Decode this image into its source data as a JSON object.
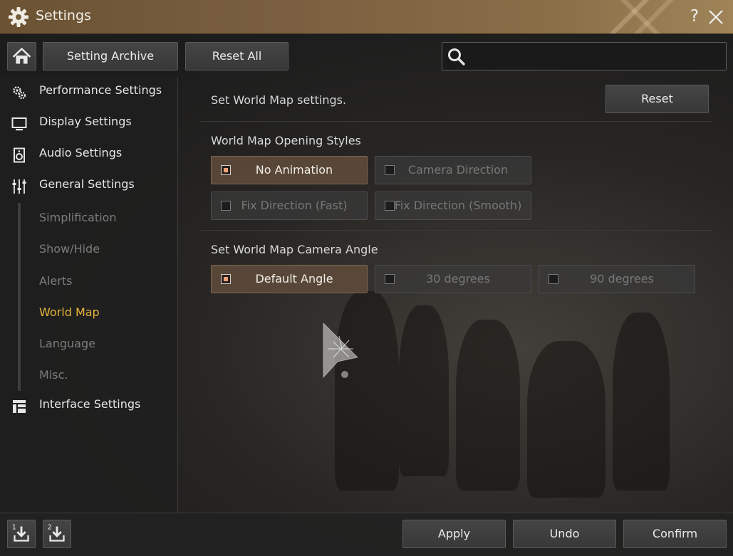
{
  "window": {
    "title": "Settings",
    "help_label": "?"
  },
  "toolbar": {
    "archive_label": "Setting Archive",
    "reset_all_label": "Reset All",
    "search_placeholder": ""
  },
  "sidebar": {
    "items": [
      {
        "label": "Performance Settings",
        "icon": "gears-icon"
      },
      {
        "label": "Display Settings",
        "icon": "monitor-icon"
      },
      {
        "label": "Audio Settings",
        "icon": "speaker-icon"
      },
      {
        "label": "General Settings",
        "icon": "sliders-icon"
      },
      {
        "label": "Interface Settings",
        "icon": "layout-icon"
      }
    ],
    "sub_items": [
      "Simplification",
      "Show/Hide",
      "Alerts",
      "World Map",
      "Language",
      "Misc."
    ],
    "active_sub_item": "World Map"
  },
  "main": {
    "description": "Set World Map settings.",
    "reset_label": "Reset",
    "opening_styles": {
      "title": "World Map Opening Styles",
      "options": [
        "No Animation",
        "Camera Direction",
        "Fix Direction (Fast)",
        "Fix Direction (Smooth)"
      ],
      "selected": "No Animation"
    },
    "camera_angle": {
      "title": "Set World Map Camera Angle",
      "options": [
        "Default Angle",
        "30 degrees",
        "90 degrees"
      ],
      "selected": "Default Angle"
    }
  },
  "bottom": {
    "slot1_label": "1",
    "slot2_label": "2",
    "apply_label": "Apply",
    "undo_label": "Undo",
    "confirm_label": "Confirm"
  },
  "colors": {
    "title_bar": "#7a6040",
    "active_sub_item": "#e7b43a",
    "selected_option": "#5c4a3a",
    "checkbox_fill": "#f2a27a"
  }
}
